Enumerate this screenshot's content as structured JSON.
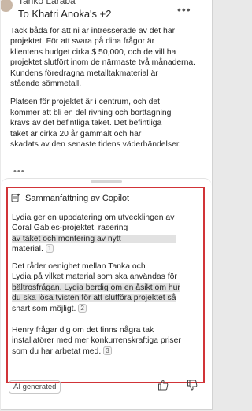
{
  "email": {
    "sender": "Tanko Laraba",
    "recipients": "To Khatri Anoka's +2",
    "more_icon": "more-horizontal-icon",
    "paragraphs": [
      "Tack båda för att ni är intresserade av det här\nprojektet. För att svara på dina frågor är\nklientens budget cirka $ 50,000, och de vill ha\nprojektet slutfört inom de närmaste två månaderna.\nKundens föredragna metalltakmaterial är\nstående sömmetall.",
      "Platsen för projektet är i centrum, och det\nkommer att bli en del rivning och borttagning\nkrävs av det befintliga taket. Det befintliga\ntaket är cirka 20 år gammalt och har\nskadats av den senaste tidens väderhändelser."
    ],
    "ellipsis": "•••"
  },
  "summary": {
    "title": "Sammanfattning av Copilot",
    "icon": "copilot-summary-icon",
    "items": [
      {
        "lines": [
          "Lydia ger en uppdatering om utvecklingen av",
          "Coral Gables-projektet. rasering",
          "av taket och montering av nytt",
          "material."
        ],
        "ref": "1"
      },
      {
        "lines": [
          "Det råder oenighet mellan Tanka och",
          "Lydia på vilket material som ska användas för",
          "bältrosfrågan. Lydia berdig om en åsikt om hur",
          "du ska lösa tvisten för att slutföra projektet så",
          "snart som möjligt."
        ],
        "ref": "2"
      },
      {
        "lines": [
          "Henry frågar dig om det finns några tak",
          "installatörer med mer konkurrenskraftiga priser",
          "som du har arbetat med."
        ],
        "ref": "3"
      }
    ]
  },
  "footer": {
    "ai_badge": "AI generated",
    "like_icon": "thumbs-up-icon",
    "dislike_icon": "thumbs-down-icon"
  },
  "colors": {
    "highlight_border": "#d13438",
    "text_highlight": "#e2e2e2"
  }
}
